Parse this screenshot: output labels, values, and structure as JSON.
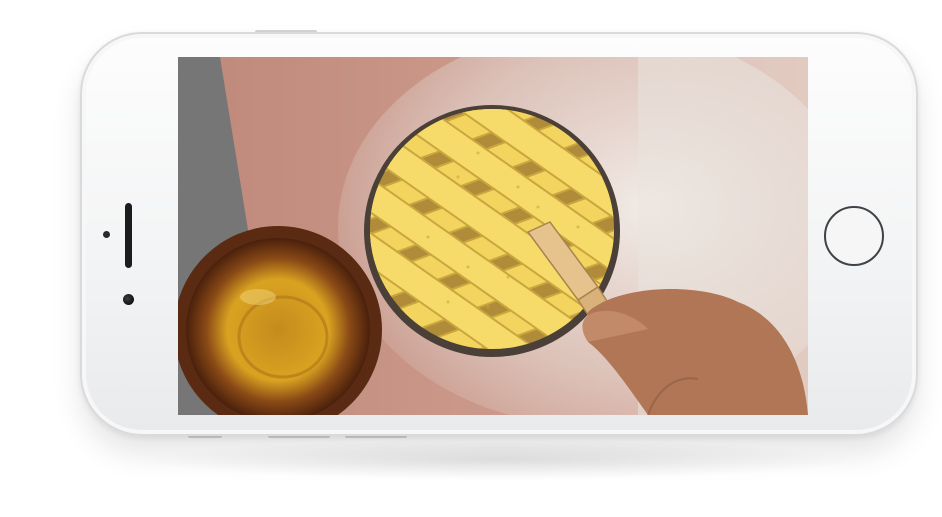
{
  "device": {
    "type": "smartphone",
    "orientation": "landscape",
    "frame_color": "#f4f4f5",
    "screen_content": {
      "scene": "pie-lattice-egg-wash",
      "colors": {
        "countertop": "#7a7a7a",
        "board": "#c99a8d",
        "flour": "#efeae6",
        "pastry": "#f3d45f",
        "pastry_shadow": "#c9a73e",
        "bowl": "#5a2a12",
        "egg_wash": "#d9a321",
        "brush_handle": "#d8b27a",
        "skin": "#b57d5e"
      }
    }
  }
}
